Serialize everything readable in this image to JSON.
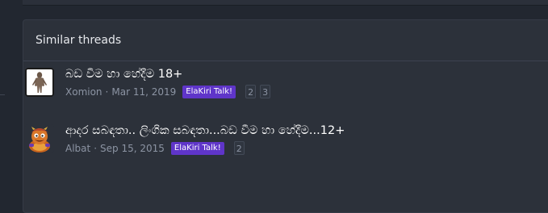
{
  "section": {
    "title": "Similar threads"
  },
  "threads": [
    {
      "title": "බඩ වීම හා හේදීම 18+",
      "author": "Xomion",
      "separator": "·",
      "date": "Mar 11, 2019",
      "prefix": "ElaKiri Talk!",
      "pages": [
        "2",
        "3"
      ],
      "avatar": "xomion-avatar"
    },
    {
      "title": "ආදර සබඳතා.. ලිංගික සබඳතා...බඩ වීම හා හේදීම...12+",
      "author": "Albat",
      "separator": "·",
      "date": "Sep 15, 2015",
      "prefix": "ElaKiri Talk!",
      "pages": [
        "2"
      ],
      "avatar": "albat-avatar"
    }
  ],
  "colors": {
    "page_background": "#222730",
    "panel_background": "#2c313a",
    "prefix_badge": "#5f35c9",
    "meta_text": "#8c94a3"
  }
}
